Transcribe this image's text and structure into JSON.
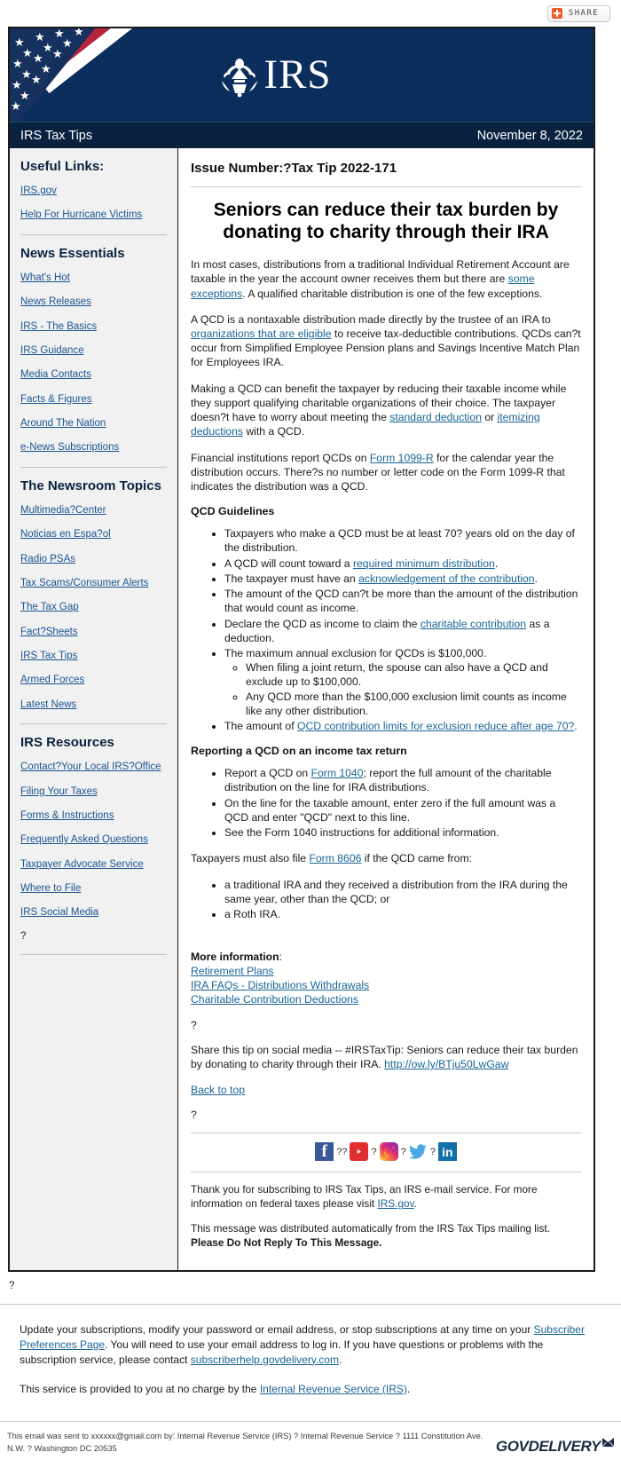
{
  "share": {
    "label": "SHARE"
  },
  "masthead": {
    "logo_text": "IRS",
    "alt": "IRS logo with US flag"
  },
  "title_bar": {
    "name": "IRS Tax Tips",
    "date": "November 8, 2022"
  },
  "sidebar": {
    "sections": [
      {
        "heading": "Useful Links:",
        "links": [
          "IRS.gov",
          "Help For Hurricane Victims"
        ]
      },
      {
        "heading": "News Essentials",
        "links": [
          "What's Hot",
          "News Releases",
          "IRS - The Basics",
          "IRS Guidance",
          "Media Contacts",
          "Facts & Figures",
          "Around The Nation",
          "e-News Subscriptions"
        ]
      },
      {
        "heading": "The Newsroom Topics",
        "links": [
          "Multimedia?Center",
          "Noticias en Espa?ol",
          "Radio PSAs",
          "Tax Scams/Consumer Alerts",
          "The Tax Gap",
          "Fact?Sheets",
          "IRS Tax Tips",
          "Armed Forces",
          "Latest News"
        ]
      },
      {
        "heading": "IRS Resources",
        "links": [
          "Contact?Your Local IRS?Office",
          "Filing Your Taxes",
          "Forms & Instructions",
          "Frequently Asked Questions",
          "Taxpayer Advocate Service",
          "Where to File",
          "IRS Social Media"
        ],
        "trailing_marker": "?"
      }
    ]
  },
  "article": {
    "issue_number": "Issue Number:?Tax Tip 2022-171",
    "headline": "Seniors can reduce their tax burden by donating to charity through their IRA",
    "p1_a": "In most cases, distributions from a traditional Individual Retirement Account are taxable in the year the account owner receives them but there are ",
    "p1_link": "some exceptions",
    "p1_b": ". A qualified charitable distribution is one of the few exceptions.",
    "p2_a": "A QCD is a nontaxable distribution made directly by the trustee of an IRA to ",
    "p2_link": "organizations that are eligible",
    "p2_b": " to receive tax-deductible contributions. QCDs can?t occur from Simplified Employee Pension plans and Savings Incentive Match Plan for Employees IRA.",
    "p3_a": "Making a QCD can benefit the taxpayer by reducing their taxable income while they support qualifying charitable organizations of their choice. The taxpayer doesn?t have to worry about meeting the ",
    "p3_link1": "standard deduction",
    "p3_mid": " or ",
    "p3_link2": "itemizing deductions",
    "p3_b": " with a QCD.",
    "p4_a": "Financial institutions report QCDs on ",
    "p4_link": "Form 1099-R",
    "p4_b": " for the calendar year the distribution occurs. There?s no number or letter code on the Form 1099-R that indicates the distribution was a QCD.",
    "guidelines_heading": "QCD Guidelines",
    "g1": "Taxpayers who make a QCD must be at least 70? years old on the day of the distribution.",
    "g2_a": "A QCD will count toward a ",
    "g2_link": "required minimum distribution",
    "g2_b": ".",
    "g3_a": "The taxpayer must have an ",
    "g3_link": "acknowledgement of the contribution",
    "g3_b": ".",
    "g4": "The amount of the QCD can?t be more than the amount of the distribution that would count as income.",
    "g5_a": "Declare the QCD as income to claim the ",
    "g5_link": "charitable contribution",
    "g5_b": " as a deduction.",
    "g6": "The maximum annual exclusion for QCDs is $100,000.",
    "g6_sub1": "When filing a joint return, the spouse can also have a QCD and exclude up to $100,000.",
    "g6_sub2": "Any QCD more than the $100,000 exclusion limit counts as income like any other distribution.",
    "g7_a": "The amount of ",
    "g7_link": "QCD contribution limits for exclusion reduce after age 70?",
    "g7_b": ".",
    "reporting_heading": "Reporting a QCD on an income tax return",
    "r1_a": "Report a QCD on ",
    "r1_link": "Form 1040",
    "r1_b": "; report the full amount of the charitable distribution on the line for IRA distributions.",
    "r2": "On the line for the taxable amount, enter zero if the full amount was a QCD and enter \"QCD\" next to this line.",
    "r3": "See the Form 1040 instructions for additional information.",
    "f8606_a": "Taxpayers must also file ",
    "f8606_link": "Form 8606",
    "f8606_b": " if the QCD came from:",
    "f1": "a traditional IRA and they received a distribution from the IRA during the same year, other than the QCD; or",
    "f2": "a Roth IRA.",
    "more_info_label": "More information",
    "more_info_colon": ":",
    "more_links": [
      "Retirement Plans",
      "IRA FAQs - Distributions Withdrawals",
      "Charitable Contribution Deductions"
    ],
    "marker1": "?",
    "share_tip_a": "Share this tip on social media -- #IRSTaxTip: Seniors can reduce their tax burden by donating to charity through their IRA. ",
    "share_tip_link": "http://ow.ly/BTju50LwGaw",
    "back_to_top": "Back to top",
    "marker2": "?"
  },
  "social": {
    "icons": [
      {
        "name": "facebook-icon",
        "glyph": "f",
        "color": "#3b5998"
      },
      {
        "name": "youtube-icon",
        "glyph": "▶",
        "color": "#e02f2f"
      },
      {
        "name": "instagram-icon",
        "glyph": "◎",
        "color": "#d6249f"
      },
      {
        "name": "twitter-icon",
        "glyph": "🐦",
        "color": "#4aa8e8"
      },
      {
        "name": "linkedin-icon",
        "glyph": "in",
        "color": "#1171a8"
      }
    ],
    "separator": "?"
  },
  "thanks": {
    "line1_a": "Thank you for subscribing to IRS Tax Tips, an IRS e-mail service. For more information on federal taxes please visit ",
    "line1_link": "IRS.gov",
    "line1_b": ".",
    "line2_a": "This message was distributed automatically from the IRS Tax Tips mailing list. ",
    "line2_bold": "Please Do Not Reply To This Message."
  },
  "outer": {
    "marker": "?",
    "sub_a": "Update your subscriptions, modify your password or email address, or stop subscriptions at any time on your ",
    "sub_link1": "Subscriber Preferences Page",
    "sub_b": ". You will need to use your email address to log in. If you have questions or problems with the subscription service, please contact ",
    "sub_link2": "subscriberhelp.govdelivery.com",
    "sub_c": ".",
    "service_a": "This service is provided to you at no charge by the ",
    "service_link": "Internal Revenue Service (IRS)",
    "service_b": "."
  },
  "legal": {
    "text": "This email was sent to xxxxxx@gmail.com by: Internal Revenue Service (IRS) ? Internal Revenue Service ? 1111 Constitution Ave. N.W. ? Washington DC 20535",
    "brand": "GOVDELIVERY"
  },
  "colors": {
    "masthead_blue": "#0b2e5c",
    "title_bar_blue": "#0a2240",
    "link_blue": "#1a6496",
    "sidebar_link_blue": "#1a5490",
    "sidebar_bg": "#f1f1f1",
    "flag_red": "#b8243c",
    "share_orange": "#f15a24"
  }
}
